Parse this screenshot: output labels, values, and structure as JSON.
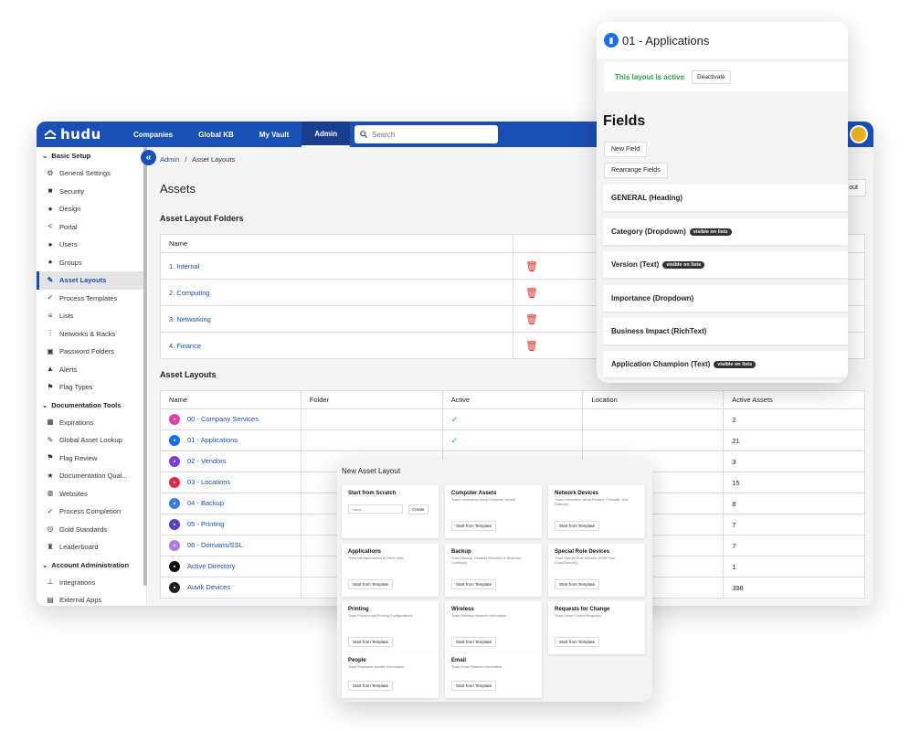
{
  "topbar": {
    "logo": "hudu",
    "nav": [
      "Companies",
      "Global KB",
      "My Vault",
      "Admin"
    ],
    "active_nav": "Admin",
    "search_placeholder": "Search"
  },
  "sidebar": {
    "sections": [
      {
        "title": "Basic Setup",
        "items": [
          {
            "label": "General Settings",
            "icon": "gear-icon"
          },
          {
            "label": "Security",
            "icon": "lock-icon"
          },
          {
            "label": "Design",
            "icon": "palette-icon"
          },
          {
            "label": "Portal",
            "icon": "share-icon"
          },
          {
            "label": "Users",
            "icon": "user-icon"
          },
          {
            "label": "Groups",
            "icon": "users-icon"
          },
          {
            "label": "Asset Layouts",
            "icon": "wrench-icon",
            "active": true
          },
          {
            "label": "Process Templates",
            "icon": "check-icon"
          },
          {
            "label": "Lists",
            "icon": "list-icon"
          },
          {
            "label": "Networks & Racks",
            "icon": "network-icon"
          },
          {
            "label": "Password Folders",
            "icon": "folder-key-icon"
          },
          {
            "label": "Alerts",
            "icon": "bell-icon"
          },
          {
            "label": "Flag Types",
            "icon": "flag-icon"
          }
        ]
      },
      {
        "title": "Documentation Tools",
        "items": [
          {
            "label": "Expirations",
            "icon": "calendar-icon"
          },
          {
            "label": "Global Asset Lookup",
            "icon": "wrench-icon"
          },
          {
            "label": "Flag Review",
            "icon": "flag-icon"
          },
          {
            "label": "Documentation Qual...",
            "icon": "star-icon"
          },
          {
            "label": "Websites",
            "icon": "globe-icon"
          },
          {
            "label": "Process Completion",
            "icon": "check-icon"
          },
          {
            "label": "Gold Standards",
            "icon": "medal-icon"
          },
          {
            "label": "Leaderboard",
            "icon": "trophy-icon"
          }
        ]
      },
      {
        "title": "Account Administration",
        "items": [
          {
            "label": "Integrations",
            "icon": "plug-icon"
          },
          {
            "label": "External Apps",
            "icon": "apps-icon"
          }
        ]
      }
    ]
  },
  "main": {
    "breadcrumb_root": "Admin",
    "breadcrumb_sep": "/",
    "breadcrumb_current": "Asset Layouts",
    "title": "Assets",
    "new_button": "out",
    "folders_title": "Asset Layout Folders",
    "folders_header": "Name",
    "folders": [
      "1. Internal",
      "2. Computing",
      "3. Networking",
      "4. Finance"
    ],
    "layouts_title": "Asset Layouts",
    "layouts_headers": [
      "Name",
      "Folder",
      "Active",
      "Location",
      "Active Assets"
    ],
    "layouts": [
      {
        "name": "00 - Company Services",
        "active": "✓",
        "count": "2",
        "color": "#e040a8"
      },
      {
        "name": "01 - Applications",
        "active": "✓",
        "count": "21",
        "color": "#1a6fe8"
      },
      {
        "name": "02 - Vendors",
        "active": "",
        "count": "3",
        "color": "#7a3fd6"
      },
      {
        "name": "03 - Locations",
        "active": "",
        "count": "15",
        "color": "#e0284a"
      },
      {
        "name": "04 - Backup",
        "active": "",
        "count": "8",
        "color": "#3d7be0"
      },
      {
        "name": "05 - Printing",
        "active": "",
        "count": "7",
        "color": "#5a3fc0"
      },
      {
        "name": "06 - Domains/SSL",
        "active": "",
        "count": "7",
        "color": "#b07ae8"
      },
      {
        "name": "Active Directory",
        "active": "",
        "count": "1",
        "color": "#111111"
      },
      {
        "name": "Auvik Devices",
        "active": "",
        "count": "398",
        "color": "#222222"
      }
    ]
  },
  "fields_panel": {
    "title": "01 - Applications",
    "active_text": "This layout is active",
    "deactivate": "Deactivate",
    "heading": "Fields",
    "new_field": "New Field",
    "rearrange": "Rearrange Fields",
    "fields": [
      {
        "label": "GENERAL (Heading)",
        "pill": ""
      },
      {
        "label": "Category (Dropdown)",
        "pill": "visible on lists"
      },
      {
        "label": "Version (Text)",
        "pill": "visible on lists"
      },
      {
        "label": "Importance (Dropdown)",
        "pill": ""
      },
      {
        "label": "Business Impact (RichText)",
        "pill": ""
      },
      {
        "label": "Application Champion (Text)",
        "pill": "visible on lists"
      }
    ]
  },
  "new_layout_panel": {
    "title": "New Asset Layout",
    "scratch_title": "Start from Scratch",
    "name_placeholder": "Name...",
    "create": "Create",
    "template_button": "Start from Template",
    "cards": [
      {
        "title": "Computer Assets",
        "desc": "Track Information about Computer Assets"
      },
      {
        "title": "Network Devices",
        "desc": "Track Information about Routers, Firewalls, and Switches"
      },
      {
        "title": "Applications",
        "desc": "Track the Applications a Client Uses"
      },
      {
        "title": "Backup",
        "desc": "Track Backup, Disaster Recovery & Business Continuity"
      },
      {
        "title": "Special Role Devices",
        "desc": "Track Special Role Devices (DVR/Time Clock/Security)"
      },
      {
        "title": "Printing",
        "desc": "Track Printers and Printing Configurations"
      },
      {
        "title": "Wireless",
        "desc": "Track Wireless Network Information"
      },
      {
        "title": "Requests for Change",
        "desc": "Track Client Control Requests"
      },
      {
        "title": "People",
        "desc": "Track Employee specific Information"
      },
      {
        "title": "Email",
        "desc": "Track Email Platform Information"
      }
    ]
  }
}
